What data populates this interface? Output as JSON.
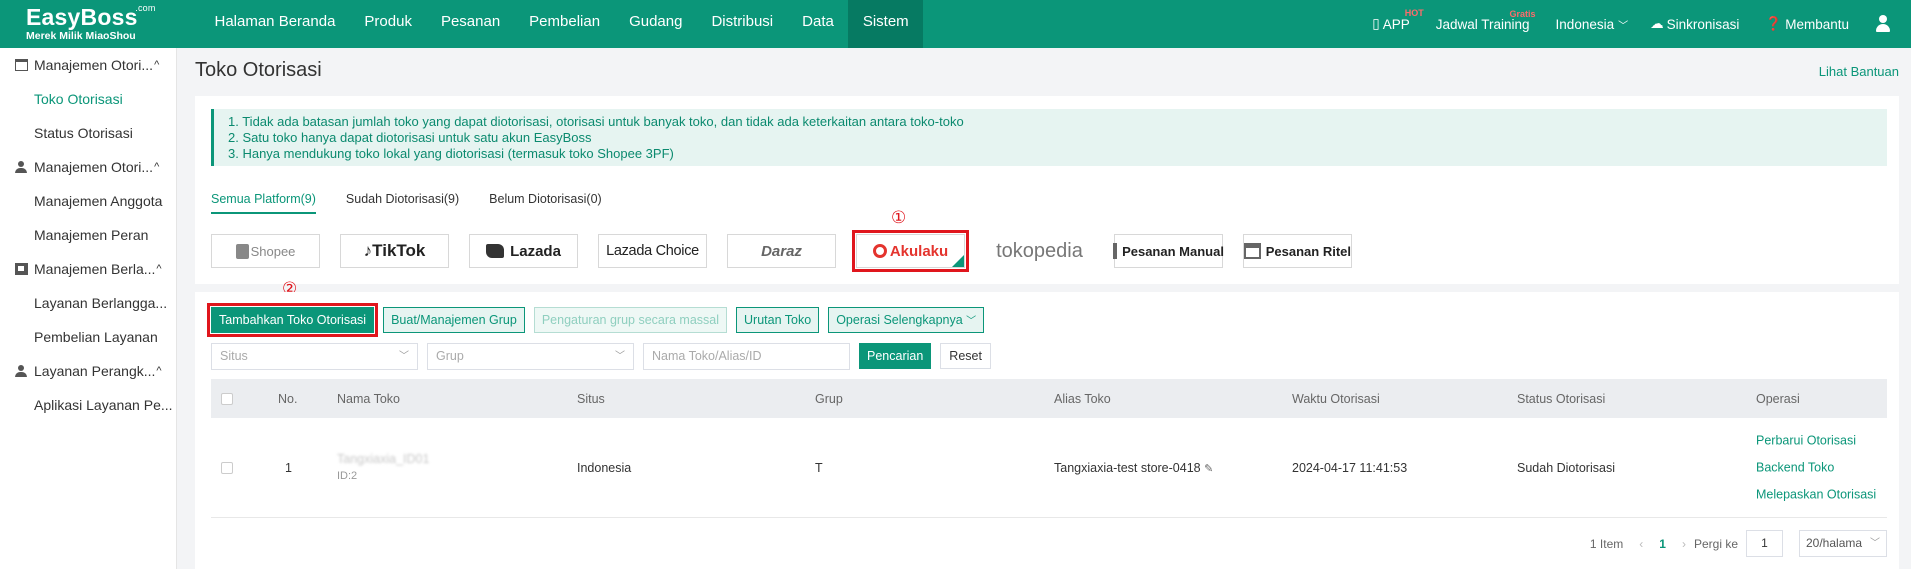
{
  "header": {
    "logo_main": "EasyBoss",
    "logo_com": ".com",
    "logo_sub": "Merek Milik MiaoShou",
    "nav": [
      {
        "label": "Halaman Beranda"
      },
      {
        "label": "Produk"
      },
      {
        "label": "Pesanan"
      },
      {
        "label": "Pembelian"
      },
      {
        "label": "Gudang"
      },
      {
        "label": "Distribusi"
      },
      {
        "label": "Data"
      },
      {
        "label": "Sistem",
        "active": true
      }
    ],
    "app_label": "APP",
    "app_badge": "HOT",
    "training_label": "Jadwal Training",
    "training_badge": "Gratis",
    "country_label": "Indonesia",
    "sync_label": "Sinkronisasi",
    "help_label": "Membantu"
  },
  "sidebar": {
    "groups": [
      {
        "label": "Manajemen Otori...",
        "icon": "store-icon",
        "items": [
          {
            "label": "Toko Otorisasi",
            "active": true
          },
          {
            "label": "Status Otorisasi"
          }
        ]
      },
      {
        "label": "Manajemen Otori...",
        "icon": "person-icon",
        "items": [
          {
            "label": "Manajemen Anggota"
          },
          {
            "label": "Manajemen Peran"
          }
        ]
      },
      {
        "label": "Manajemen Berla...",
        "icon": "service-icon",
        "items": [
          {
            "label": "Layanan Berlangga..."
          },
          {
            "label": "Pembelian Layanan"
          }
        ]
      },
      {
        "label": "Layanan Perangk...",
        "icon": "person-icon",
        "items": [
          {
            "label": "Aplikasi Layanan Pe..."
          }
        ]
      }
    ]
  },
  "page": {
    "title": "Toko Otorisasi",
    "help_link": "Lihat Bantuan",
    "notices": [
      "1. Tidak ada batasan jumlah toko yang dapat diotorisasi, otorisasi untuk banyak toko, dan tidak ada keterkaitan antara toko-toko",
      "2. Satu toko hanya dapat diotorisasi untuk satu akun EasyBoss",
      "3. Hanya mendukung toko lokal yang diotorisasi (termasuk toko Shopee 3PF)"
    ],
    "tabs": [
      {
        "label": "Semua Platform(9)",
        "active": true
      },
      {
        "label": "Sudah Diotorisasi(9)"
      },
      {
        "label": "Belum Diotorisasi(0)"
      }
    ],
    "platforms": [
      {
        "label": "Shopee",
        "key": "shopee"
      },
      {
        "label": "TikTok",
        "key": "tiktok"
      },
      {
        "label": "Lazada",
        "key": "lazada"
      },
      {
        "label": "Lazada Choice",
        "key": "choice"
      },
      {
        "label": "Daraz",
        "key": "daraz"
      },
      {
        "label": "Akulaku",
        "key": "akulaku",
        "selected": true
      },
      {
        "label": "tokopedia",
        "key": "tokopedia"
      },
      {
        "label": "Pesanan Manual",
        "key": "manual"
      },
      {
        "label": "Pesanan Ritel",
        "key": "ritel"
      }
    ],
    "marker_1": "①",
    "marker_2": "②"
  },
  "toolbar": {
    "add_label": "Tambahkan Toko Otorisasi",
    "group_label": "Buat/Manajemen Grup",
    "mass_group_label": "Pengaturan grup secara massal",
    "sort_label": "Urutan Toko",
    "more_label": "Operasi Selengkapnya"
  },
  "filters": {
    "site_placeholder": "Situs",
    "group_placeholder": "Grup",
    "name_placeholder": "Nama Toko/Alias/ID",
    "search_label": "Pencarian",
    "reset_label": "Reset"
  },
  "table": {
    "columns": [
      "No.",
      "Nama Toko",
      "Situs",
      "Grup",
      "Alias Toko",
      "Waktu Otorisasi",
      "Status Otorisasi",
      "Operasi"
    ],
    "rows": [
      {
        "no": "1",
        "name": "Tangxiaxia_ID01",
        "id_label": "ID:2",
        "site": "Indonesia",
        "group": "T",
        "alias": "Tangxiaxia-test store-0418",
        "time": "2024-04-17 11:41:53",
        "status": "Sudah Diotorisasi",
        "ops": [
          "Perbarui Otorisasi",
          "Backend Toko",
          "Melepaskan Otorisasi"
        ]
      }
    ]
  },
  "pagination": {
    "total": "1 Item",
    "current": "1",
    "goto_label": "Pergi ke",
    "goto_value": "1",
    "page_size": "20/halama"
  }
}
